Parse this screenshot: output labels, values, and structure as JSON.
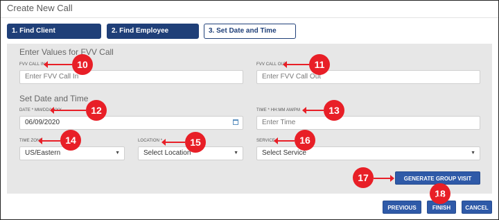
{
  "dialog": {
    "title": "Create New Call"
  },
  "steps": [
    {
      "label": "1. Find Client"
    },
    {
      "label": "2. Find Employee"
    },
    {
      "label": "3. Set Date and Time"
    }
  ],
  "fvv": {
    "heading": "Enter Values for FVV Call",
    "call_in": {
      "label": "FVV CALL IN",
      "placeholder": "Enter FVV Call In"
    },
    "call_out": {
      "label": "FVV CALL OUT",
      "placeholder": "Enter FVV Call Out"
    }
  },
  "datetime": {
    "heading": "Set Date and Time",
    "date": {
      "label": "DATE * MM/DD/YYYY",
      "value": "06/09/2020",
      "icon": "calendar-icon"
    },
    "time": {
      "label": "TIME * HH:MM AM/PM",
      "placeholder": "Enter Time"
    },
    "timezone": {
      "label": "TIME ZONE",
      "value": "US/Eastern"
    },
    "location": {
      "label": "LOCATION *",
      "value": "Select Location"
    },
    "service": {
      "label": "SERVICE",
      "value": "Select Service"
    },
    "caret": "▼"
  },
  "buttons": {
    "group_visit": "GENERATE GROUP VISIT CODE",
    "previous": "PREVIOUS",
    "finish": "FINISH",
    "cancel": "CANCEL"
  },
  "callouts": [
    "10",
    "11",
    "12",
    "13",
    "14",
    "15",
    "16",
    "17",
    "18"
  ],
  "colors": {
    "primary": "#2f5aa8",
    "step_done": "#1f3f78",
    "callout": "#e81f27",
    "panel": "#e7e7e7"
  }
}
